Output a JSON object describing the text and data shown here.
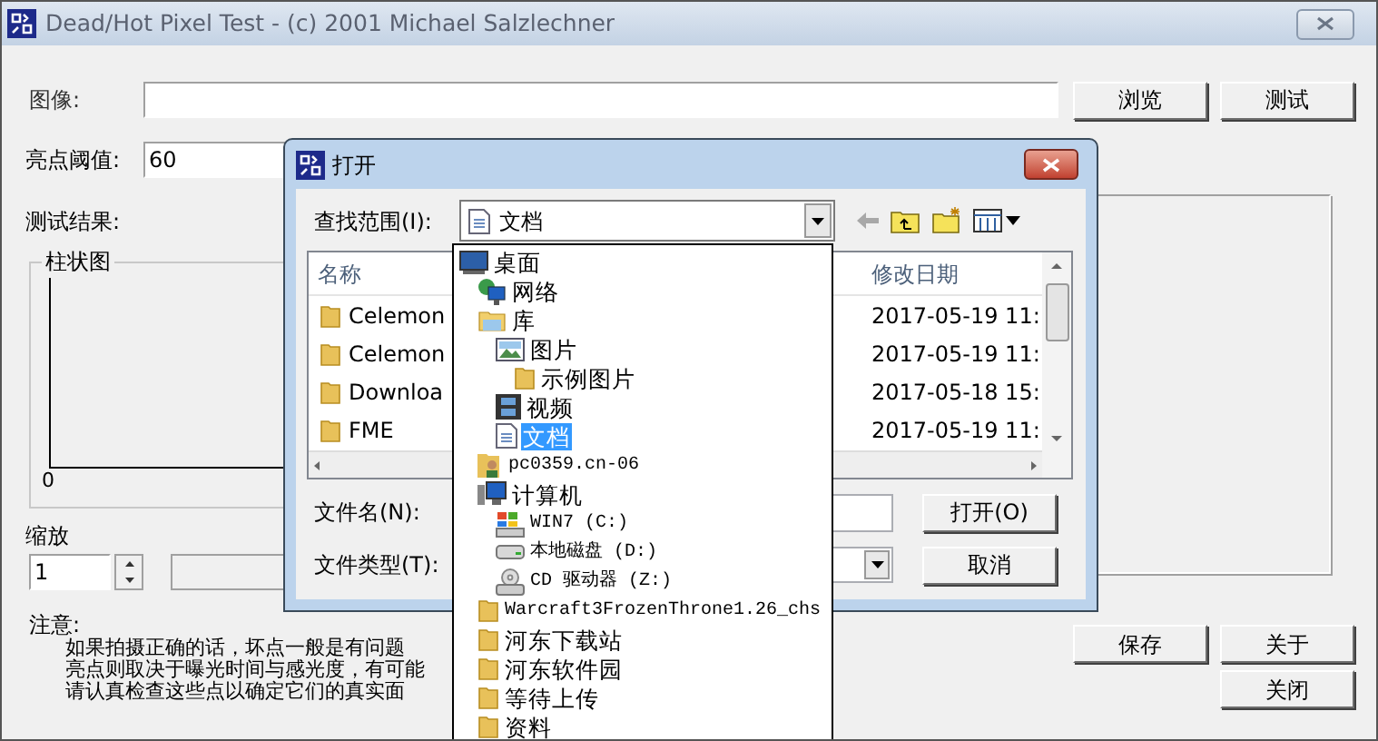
{
  "window": {
    "title": "Dead/Hot Pixel Test - (c) 2001 Michael Salzlechner"
  },
  "image_row": {
    "label": "图像:",
    "browse_button": "浏览",
    "test_button": "测试"
  },
  "threshold": {
    "label": "亮点阈值:",
    "value": "60"
  },
  "results": {
    "label": "测试结果:",
    "histogram": {
      "title": "柱状图",
      "axis_label": "0"
    }
  },
  "zoom": {
    "label": "缩放",
    "value": "1"
  },
  "note": {
    "label": "注意:",
    "lines": [
      "如果拍摄正确的话，坏点一般是有问题",
      "亮点则取决于曝光时间与感光度，有可能",
      "请认真检查这些点以确定它们的真实面"
    ]
  },
  "buttons": {
    "save": "保存",
    "about": "关于",
    "close": "关闭"
  },
  "open_dialog": {
    "title": "打开",
    "look_in": {
      "label": "查找范围(I):",
      "value": "文档"
    },
    "columns": [
      "名称",
      "修改日期"
    ],
    "files": [
      {
        "name": "Celemon",
        "modified": "2017-05-19 11:"
      },
      {
        "name": "Celemon",
        "modified": "2017-05-19 11:"
      },
      {
        "name": "Downloa",
        "modified": "2017-05-18 15:"
      },
      {
        "name": "FME",
        "modified": "2017-05-19 11:"
      }
    ],
    "file_name": {
      "label": "文件名(N):"
    },
    "file_type": {
      "label": "文件类型(T):"
    },
    "open_button": "打开(O)",
    "cancel_button": "取消",
    "look_in_list": [
      {
        "label": "桌面",
        "kind": "desktop",
        "selected": false,
        "children": [
          {
            "label": "网络",
            "kind": "network",
            "selected": false
          },
          {
            "label": "库",
            "kind": "library",
            "selected": false,
            "children": [
              {
                "label": "图片",
                "kind": "pictures",
                "selected": false,
                "children": [
                  {
                    "label": "示例图片",
                    "kind": "folder",
                    "selected": false
                  }
                ]
              },
              {
                "label": "视频",
                "kind": "video",
                "selected": false
              },
              {
                "label": "文档",
                "kind": "document",
                "selected": true
              }
            ]
          },
          {
            "label": "pc0359.cn-06",
            "kind": "user",
            "selected": false
          },
          {
            "label": "计算机",
            "kind": "computer",
            "selected": false,
            "children": [
              {
                "label": "WIN7 (C:)",
                "kind": "system-drive",
                "selected": false
              },
              {
                "label": "本地磁盘 (D:)",
                "kind": "drive",
                "selected": false
              },
              {
                "label": "CD 驱动器 (Z:)",
                "kind": "cd-drive",
                "selected": false
              }
            ]
          },
          {
            "label": "Warcraft3FrozenThrone1.26_chs",
            "kind": "folder",
            "selected": false
          },
          {
            "label": "河东下载站",
            "kind": "folder",
            "selected": false
          },
          {
            "label": "河东软件园",
            "kind": "folder",
            "selected": false
          },
          {
            "label": "等待上传",
            "kind": "folder",
            "selected": false
          },
          {
            "label": "资料",
            "kind": "folder",
            "selected": false
          }
        ]
      }
    ]
  }
}
